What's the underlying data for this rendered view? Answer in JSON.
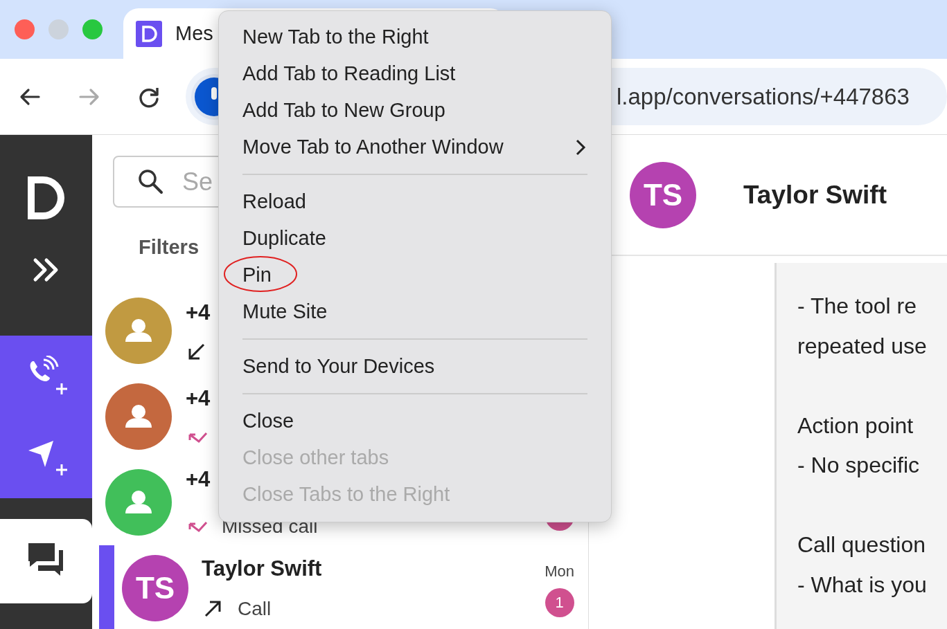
{
  "browser": {
    "tabs": [
      {
        "title": "Mes",
        "selected": true
      }
    ],
    "nav_buttons": [
      {
        "kind": "back",
        "disabled": false
      },
      {
        "kind": "forward",
        "disabled": true
      },
      {
        "kind": "reload",
        "disabled": false
      }
    ],
    "address": {
      "url": "l.app/conversations/+447863"
    }
  },
  "sidebar": {
    "items": [
      {
        "kind": "expand",
        "selected": false
      },
      {
        "kind": "new-call",
        "selected": false
      },
      {
        "kind": "new-message",
        "selected": false
      },
      {
        "kind": "conversations",
        "selected": true
      }
    ]
  },
  "conversation_list": {
    "search": {
      "placeholder": "Se"
    },
    "filters_label": "Filters",
    "rows": [
      {
        "name": "+4",
        "avatar": {
          "kind": "person",
          "color": "#c19a41"
        },
        "call": {
          "kind": "incoming"
        },
        "selected": false
      },
      {
        "name": "+4",
        "avatar": {
          "kind": "person",
          "color": "#c4683f"
        },
        "call": {
          "kind": "missed"
        },
        "selected": false
      },
      {
        "name": "+4",
        "avatar": {
          "kind": "person",
          "color": "#41bf5a"
        },
        "call": {
          "kind": "missed"
        },
        "preview": "Missed call",
        "badge": true,
        "selected": false
      },
      {
        "name": "Taylor Swift",
        "avatar": {
          "kind": "initials",
          "initials": "TS",
          "color": "#b542b0"
        },
        "call": {
          "kind": "outgoing"
        },
        "preview": "Call",
        "time": "Mon",
        "badge": true,
        "unread": "1",
        "selected": true
      }
    ]
  },
  "chat": {
    "contact": {
      "name": "Taylor Swift",
      "initials": "TS",
      "color": "#b542b0"
    },
    "paragraphs": [
      {
        "lines": [
          "- The tool re",
          "repeated use"
        ]
      },
      {
        "lines": [
          "Action point",
          "- No specific"
        ]
      },
      {
        "lines": [
          "Call question",
          "- What is you"
        ]
      }
    ]
  },
  "context_menu": {
    "items": [
      {
        "kind": "item",
        "label": "New Tab to the Right",
        "disabled": false,
        "submenu": false,
        "circled": false
      },
      {
        "kind": "item",
        "label": "Add Tab to Reading List",
        "disabled": false,
        "submenu": false,
        "circled": false
      },
      {
        "kind": "item",
        "label": "Add Tab to New Group",
        "disabled": false,
        "submenu": false,
        "circled": false
      },
      {
        "kind": "item",
        "label": "Move Tab to Another Window",
        "disabled": false,
        "submenu": true,
        "circled": false
      },
      {
        "kind": "separator"
      },
      {
        "kind": "item",
        "label": "Reload",
        "disabled": false,
        "submenu": false,
        "circled": false
      },
      {
        "kind": "item",
        "label": "Duplicate",
        "disabled": false,
        "submenu": false,
        "circled": false
      },
      {
        "kind": "item",
        "label": "Pin",
        "disabled": false,
        "submenu": false,
        "circled": true
      },
      {
        "kind": "item",
        "label": "Mute Site",
        "disabled": false,
        "submenu": false,
        "circled": false
      },
      {
        "kind": "separator"
      },
      {
        "kind": "item",
        "label": "Send to Your Devices",
        "disabled": false,
        "submenu": false,
        "circled": false
      },
      {
        "kind": "separator"
      },
      {
        "kind": "item",
        "label": "Close",
        "disabled": false,
        "submenu": false,
        "circled": false
      },
      {
        "kind": "item",
        "label": "Close other tabs",
        "disabled": true,
        "submenu": false,
        "circled": false
      },
      {
        "kind": "item",
        "label": "Close Tabs to the Right",
        "disabled": true,
        "submenu": false,
        "circled": false
      }
    ]
  }
}
